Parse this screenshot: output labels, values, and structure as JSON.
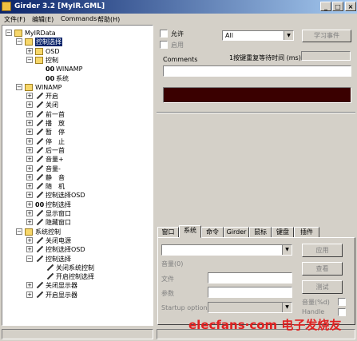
{
  "window": {
    "title": "Girder 3.2 [MyIR.GML]"
  },
  "title_buttons": {
    "minimize": "_",
    "maximize": "□",
    "close": "×"
  },
  "menu": [
    "文件(F)",
    "编辑(E)",
    "Commands",
    "帮助(H)"
  ],
  "tree": [
    {
      "label": "MyIRData",
      "indent": 0,
      "expander": "−",
      "icon": "folder-icon"
    },
    {
      "label": "控制选择",
      "indent": 1,
      "expander": "−",
      "icon": "folder-icon",
      "selected": true
    },
    {
      "label": "OSD",
      "indent": 2,
      "expander": "+",
      "icon": "folder-icon"
    },
    {
      "label": "控制",
      "indent": 2,
      "expander": "−",
      "icon": "folder-icon"
    },
    {
      "label": "WINAMP",
      "indent": 3,
      "expander": "",
      "icon": "multigroup-icon"
    },
    {
      "label": "系统",
      "indent": 3,
      "expander": "",
      "icon": "multigroup-icon"
    },
    {
      "label": "WINAMP",
      "indent": 1,
      "expander": "−",
      "icon": "folder-icon"
    },
    {
      "label": "开启",
      "indent": 2,
      "expander": "+",
      "icon": "command-icon"
    },
    {
      "label": "关闭",
      "indent": 2,
      "expander": "+",
      "icon": "command-icon"
    },
    {
      "label": "前一首",
      "indent": 2,
      "expander": "+",
      "icon": "command-icon"
    },
    {
      "label": "播　放",
      "indent": 2,
      "expander": "+",
      "icon": "command-icon"
    },
    {
      "label": "暂　停",
      "indent": 2,
      "expander": "+",
      "icon": "command-icon"
    },
    {
      "label": "停　止",
      "indent": 2,
      "expander": "+",
      "icon": "command-icon"
    },
    {
      "label": "后一首",
      "indent": 2,
      "expander": "+",
      "icon": "command-icon"
    },
    {
      "label": "音量+",
      "indent": 2,
      "expander": "+",
      "icon": "command-icon"
    },
    {
      "label": "音量-",
      "indent": 2,
      "expander": "+",
      "icon": "command-icon"
    },
    {
      "label": "静　音",
      "indent": 2,
      "expander": "+",
      "icon": "command-icon"
    },
    {
      "label": "随　机",
      "indent": 2,
      "expander": "+",
      "icon": "command-icon"
    },
    {
      "label": "控制选择OSD",
      "indent": 2,
      "expander": "+",
      "icon": "command-icon"
    },
    {
      "label": "控制选择",
      "indent": 2,
      "expander": "+",
      "icon": "multigroup-icon"
    },
    {
      "label": "显示窗口",
      "indent": 2,
      "expander": "+",
      "icon": "command-icon"
    },
    {
      "label": "隐藏窗口",
      "indent": 2,
      "expander": "+",
      "icon": "command-icon"
    },
    {
      "label": "系统控制",
      "indent": 1,
      "expander": "−",
      "icon": "folder-icon"
    },
    {
      "label": "关闭电源",
      "indent": 2,
      "expander": "+",
      "icon": "command-icon"
    },
    {
      "label": "控制选择OSD",
      "indent": 2,
      "expander": "+",
      "icon": "command-icon"
    },
    {
      "label": "控制选择",
      "indent": 2,
      "expander": "−",
      "icon": "command-icon"
    },
    {
      "label": "关闭系统控制",
      "indent": 3,
      "expander": "",
      "icon": "command-icon"
    },
    {
      "label": "开启控制选择",
      "indent": 3,
      "expander": "",
      "icon": "command-icon"
    },
    {
      "label": "关闭显示器",
      "indent": 2,
      "expander": "+",
      "icon": "command-icon"
    },
    {
      "label": "开启显示器",
      "indent": 2,
      "expander": "+",
      "icon": "command-icon"
    }
  ],
  "top_panel": {
    "allow_label": "允许",
    "disabled_check_label": "启用",
    "event_select_value": "All",
    "learn_event_button": "学习事件",
    "comments_label": "Comments",
    "repeat_wait_label": "1按键重复等待时间 (ms)",
    "repeat_wait_value": "",
    "comments_value": "",
    "display_color": "#3a0000"
  },
  "tabs": [
    "窗口",
    "系统",
    "命令",
    "Girder",
    "鼠标",
    "键盘",
    "插件"
  ],
  "active_tab": "系统",
  "bottom_panel": {
    "select_value": "",
    "apply_button": "应用",
    "browse_button": "查看",
    "test_button": "测试",
    "volume_label": "音量(0)",
    "file_label": "文件",
    "param_label": "参数",
    "startup_label": "Startup options",
    "volume_ok_label": "音量(%d)",
    "handle_label": "Handle"
  },
  "watermark": {
    "text": "elecfans·com 电子发烧友"
  }
}
